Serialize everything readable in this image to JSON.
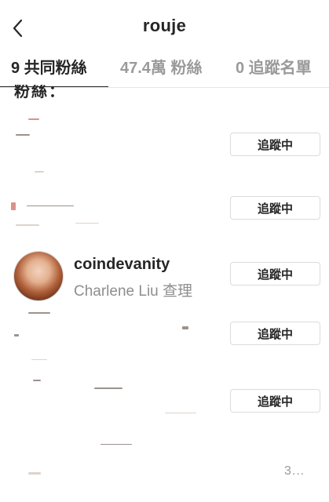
{
  "header": {
    "title": "rouje",
    "back_icon": "chevron-left-icon"
  },
  "tabs": [
    {
      "label": "9 共同粉絲",
      "active": true
    },
    {
      "label": "47.4萬 粉絲",
      "active": false
    },
    {
      "label": "0 追蹤名單",
      "active": false
    }
  ],
  "section": {
    "label": "粉絲："
  },
  "rows": [
    {
      "username": "",
      "fullname": "",
      "button": "追蹤中"
    },
    {
      "username": "",
      "fullname": "",
      "button": "追蹤中"
    },
    {
      "username": "coindevanity",
      "fullname": "Charlene Liu 查理",
      "button": "追蹤中"
    },
    {
      "username": "",
      "fullname": "",
      "button": "追蹤中"
    },
    {
      "username": "",
      "fullname": "",
      "button": "追蹤中"
    }
  ],
  "partial_row": {
    "ellipsis": "3..."
  },
  "colors": {
    "text": "#262626",
    "secondary": "#8e8e8e",
    "tab_inactive": "#9a9a9a",
    "border": "#dbdbdb"
  }
}
